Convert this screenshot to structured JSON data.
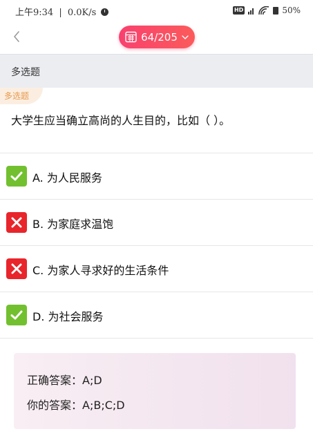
{
  "status_bar": {
    "time": "上午9:34",
    "separator": "|",
    "network_speed": "0.0K/s",
    "battery": "50%",
    "hd_label": "HD"
  },
  "header": {
    "counter": "64/205",
    "accent_color": "#f9406e"
  },
  "section": {
    "title": "多选题"
  },
  "question": {
    "type_badge": "多选题",
    "text": "大学生应当确立高尚的人生目的，比如（ ）。",
    "options": [
      {
        "label": "A. 为人民服务",
        "status": "correct"
      },
      {
        "label": "B. 为家庭求温饱",
        "status": "wrong"
      },
      {
        "label": "C. 为家人寻求好的生活条件",
        "status": "wrong"
      },
      {
        "label": "D. 为社会服务",
        "status": "correct"
      }
    ]
  },
  "answer": {
    "correct": "正确答案：A;D",
    "yours": "你的答案：A;B;C;D"
  },
  "colors": {
    "correct": "#72c02f",
    "wrong": "#e8252b",
    "badge_text": "#e79a4e"
  }
}
